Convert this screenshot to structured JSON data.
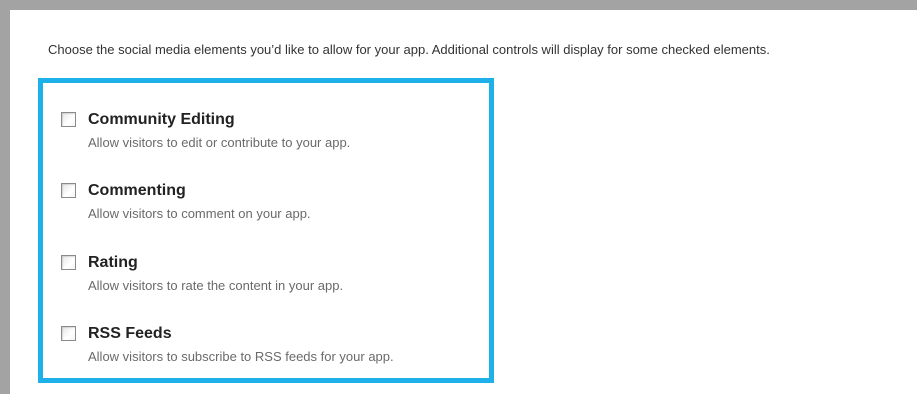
{
  "intro_text": "Choose the social media elements you’d like to allow for your app. Additional controls will display for some checked elements.",
  "accent_color": "#1eb0e8",
  "options": [
    {
      "title": "Community Editing",
      "description": "Allow visitors to edit or contribute to your app.",
      "checked": false
    },
    {
      "title": "Commenting",
      "description": "Allow visitors to comment on your app.",
      "checked": false
    },
    {
      "title": "Rating",
      "description": "Allow visitors to rate the content in your app.",
      "checked": false
    },
    {
      "title": "RSS Feeds",
      "description": "Allow visitors to subscribe to RSS feeds for your app.",
      "checked": false
    }
  ]
}
